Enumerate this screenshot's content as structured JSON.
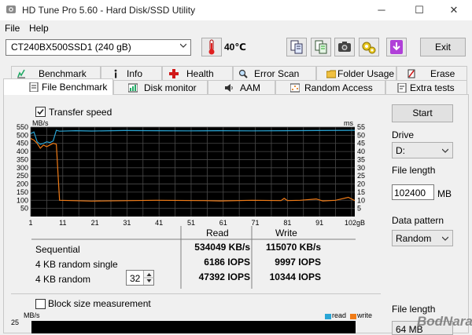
{
  "window": {
    "title": "HD Tune Pro 5.60 - Hard Disk/SSD Utility",
    "minimize": "─",
    "maximize": "☐",
    "close": "✕"
  },
  "menu": {
    "file": "File",
    "help": "Help"
  },
  "toolbar": {
    "drive": "CT240BX500SSD1 (240 gB)",
    "temperature": "40℃",
    "exit": "Exit",
    "icons": [
      "thermometer-icon",
      "copy-info-icon",
      "copy-text-icon",
      "screenshot-icon",
      "options-icon",
      "download-icon"
    ]
  },
  "tabs": {
    "top": [
      {
        "label": "Benchmark",
        "icon": "benchmark-icon"
      },
      {
        "label": "Info",
        "icon": "info-icon"
      },
      {
        "label": "Health",
        "icon": "health-icon"
      },
      {
        "label": "Error Scan",
        "icon": "error-scan-icon"
      },
      {
        "label": "Folder Usage",
        "icon": "folder-icon"
      },
      {
        "label": "Erase",
        "icon": "erase-icon"
      }
    ],
    "bottom": [
      {
        "label": "File Benchmark",
        "icon": "file-benchmark-icon",
        "active": true
      },
      {
        "label": "Disk monitor",
        "icon": "disk-monitor-icon"
      },
      {
        "label": "AAM",
        "icon": "speaker-icon"
      },
      {
        "label": "Random Access",
        "icon": "random-access-icon"
      },
      {
        "label": "Extra tests",
        "icon": "extra-tests-icon"
      }
    ]
  },
  "benchmark": {
    "transfer_speed_label": "Transfer speed",
    "transfer_speed_checked": true,
    "block_size_label": "Block size measurement",
    "block_size_checked": false
  },
  "results": {
    "header_read": "Read",
    "header_write": "Write",
    "rows": [
      {
        "label": "Sequential",
        "read": "534049 KB/s",
        "write": "115070 KB/s"
      },
      {
        "label": "4 KB random single",
        "read": "6186 IOPS",
        "write": "9997 IOPS"
      },
      {
        "label": "4 KB random",
        "read": "47392 IOPS",
        "write": "10344 IOPS"
      }
    ],
    "queue_depth": "32"
  },
  "side": {
    "start": "Start",
    "drive_label": "Drive",
    "drive_value": "D:",
    "file_length_label": "File length",
    "file_length_value": "102400",
    "file_length_unit": "MB",
    "pattern_label": "Data pattern",
    "pattern_value": "Random",
    "file_length2_label": "File length",
    "file_length2_value": "64 MB"
  },
  "block_chart": {
    "ylabel": "MB/s",
    "ytop": "25",
    "legend_read": "read",
    "legend_write": "write"
  },
  "watermark": "BodNara",
  "colors": {
    "read": "#2aa6d6",
    "write": "#f07b16",
    "grid": "#4a4a4a",
    "bg": "#000000"
  },
  "chart_data": {
    "type": "line",
    "title": "",
    "xlabel": "",
    "ylabel": "MB/s",
    "y2label": "ms",
    "xlim": [
      1,
      102
    ],
    "ylim": [
      0,
      550
    ],
    "x_ticks": [
      "1",
      "11",
      "21",
      "31",
      "41",
      "51",
      "61",
      "71",
      "81",
      "91",
      "102gB"
    ],
    "y_ticks": [
      "50",
      "100",
      "150",
      "200",
      "250",
      "300",
      "350",
      "400",
      "450",
      "500",
      "550"
    ],
    "y2_ticks": [
      "5",
      "10",
      "15",
      "20",
      "25",
      "30",
      "35",
      "40",
      "45",
      "50",
      "55"
    ],
    "series": [
      {
        "name": "read",
        "x": [
          1,
          2,
          3,
          4,
          5,
          6,
          7,
          8,
          9,
          10,
          15,
          20,
          30,
          40,
          50,
          60,
          70,
          80,
          90,
          102
        ],
        "y": [
          510,
          520,
          460,
          445,
          450,
          460,
          455,
          465,
          530,
          525,
          528,
          526,
          529,
          528,
          527,
          528,
          527,
          528,
          529,
          530
        ]
      },
      {
        "name": "write",
        "x": [
          1,
          2,
          3,
          4,
          5,
          6,
          7,
          8,
          9,
          10,
          20,
          40,
          55,
          60,
          70,
          79,
          80,
          81,
          85,
          90,
          92,
          96,
          100,
          102
        ],
        "y": [
          480,
          470,
          450,
          420,
          440,
          430,
          440,
          450,
          445,
          100,
          95,
          100,
          98,
          96,
          100,
          98,
          112,
          98,
          100,
          108,
          96,
          100,
          118,
          98
        ]
      }
    ]
  }
}
